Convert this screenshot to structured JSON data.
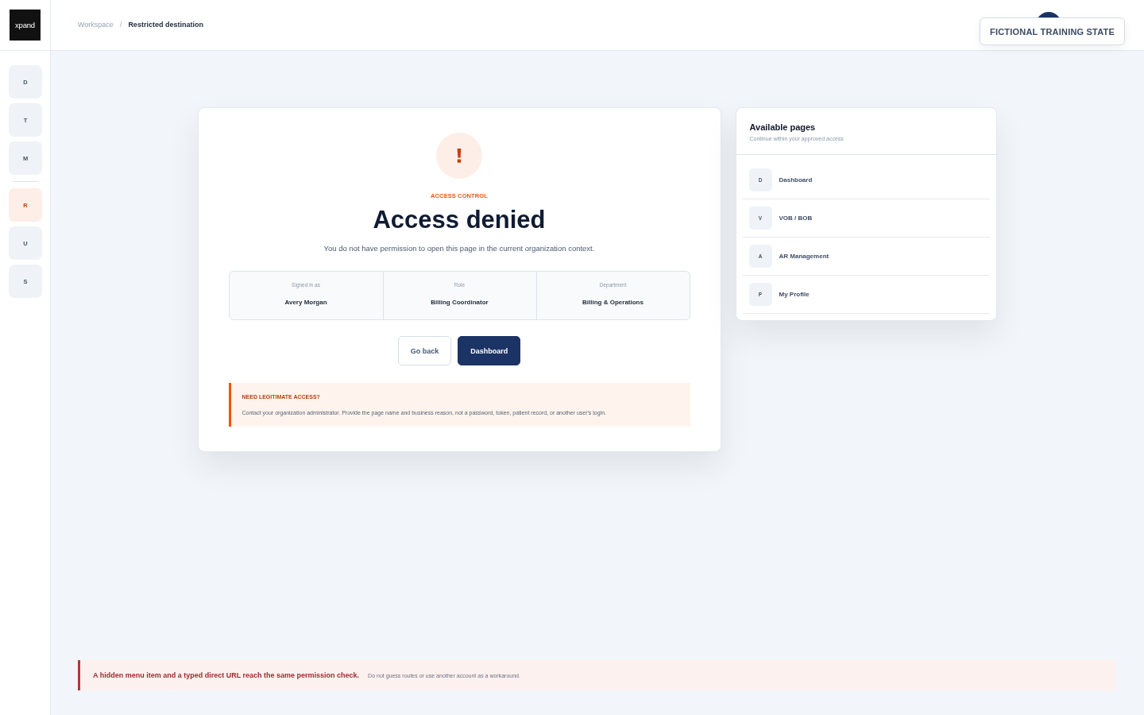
{
  "header": {
    "logo": "xpand",
    "breadcrumb": {
      "separator": "/",
      "items": [
        {
          "label": "Workspace",
          "current": false
        },
        {
          "label": "Restricted destination",
          "current": true
        }
      ]
    },
    "training_badge": "FICTIONAL TRAINING STATE"
  },
  "sidebar": {
    "groups": [
      {
        "items": [
          {
            "letter": "D",
            "selected": false
          },
          {
            "letter": "T",
            "selected": false
          },
          {
            "letter": "M",
            "selected": false
          }
        ]
      },
      {
        "items": [
          {
            "letter": "R",
            "selected": true
          },
          {
            "letter": "U",
            "selected": false
          },
          {
            "letter": "S",
            "selected": false
          }
        ]
      }
    ]
  },
  "access_card": {
    "eyebrow": "ACCESS CONTROL",
    "title": "Access denied",
    "message": "You do not have permission to open this page in the current organization context.",
    "details": [
      {
        "label": "Signed in as",
        "value": "Avery Morgan"
      },
      {
        "label": "Role",
        "value": "Billing Coordinator"
      },
      {
        "label": "Department",
        "value": "Billing & Operations"
      }
    ],
    "actions": [
      {
        "label": "Go back",
        "kind": "secondary"
      },
      {
        "label": "Dashboard",
        "kind": "primary"
      }
    ],
    "notice": {
      "title": "NEED LEGITIMATE ACCESS?",
      "text": "Contact your organization administrator. Provide the page name and business reason, not a password, token, patient record, or another user's login."
    }
  },
  "available_pages": {
    "title": "Available pages",
    "subtitle": "Continue within your approved access",
    "items": [
      {
        "letter": "D",
        "label": "Dashboard"
      },
      {
        "letter": "V",
        "label": "VOB / BOB"
      },
      {
        "letter": "A",
        "label": "AR Management"
      },
      {
        "letter": "P",
        "label": "My Profile"
      }
    ]
  },
  "footer_alert": {
    "headline": "A hidden menu item and a typed direct URL reach the same permission check.",
    "text": "Do not guess routes or use another account as a workaround."
  }
}
